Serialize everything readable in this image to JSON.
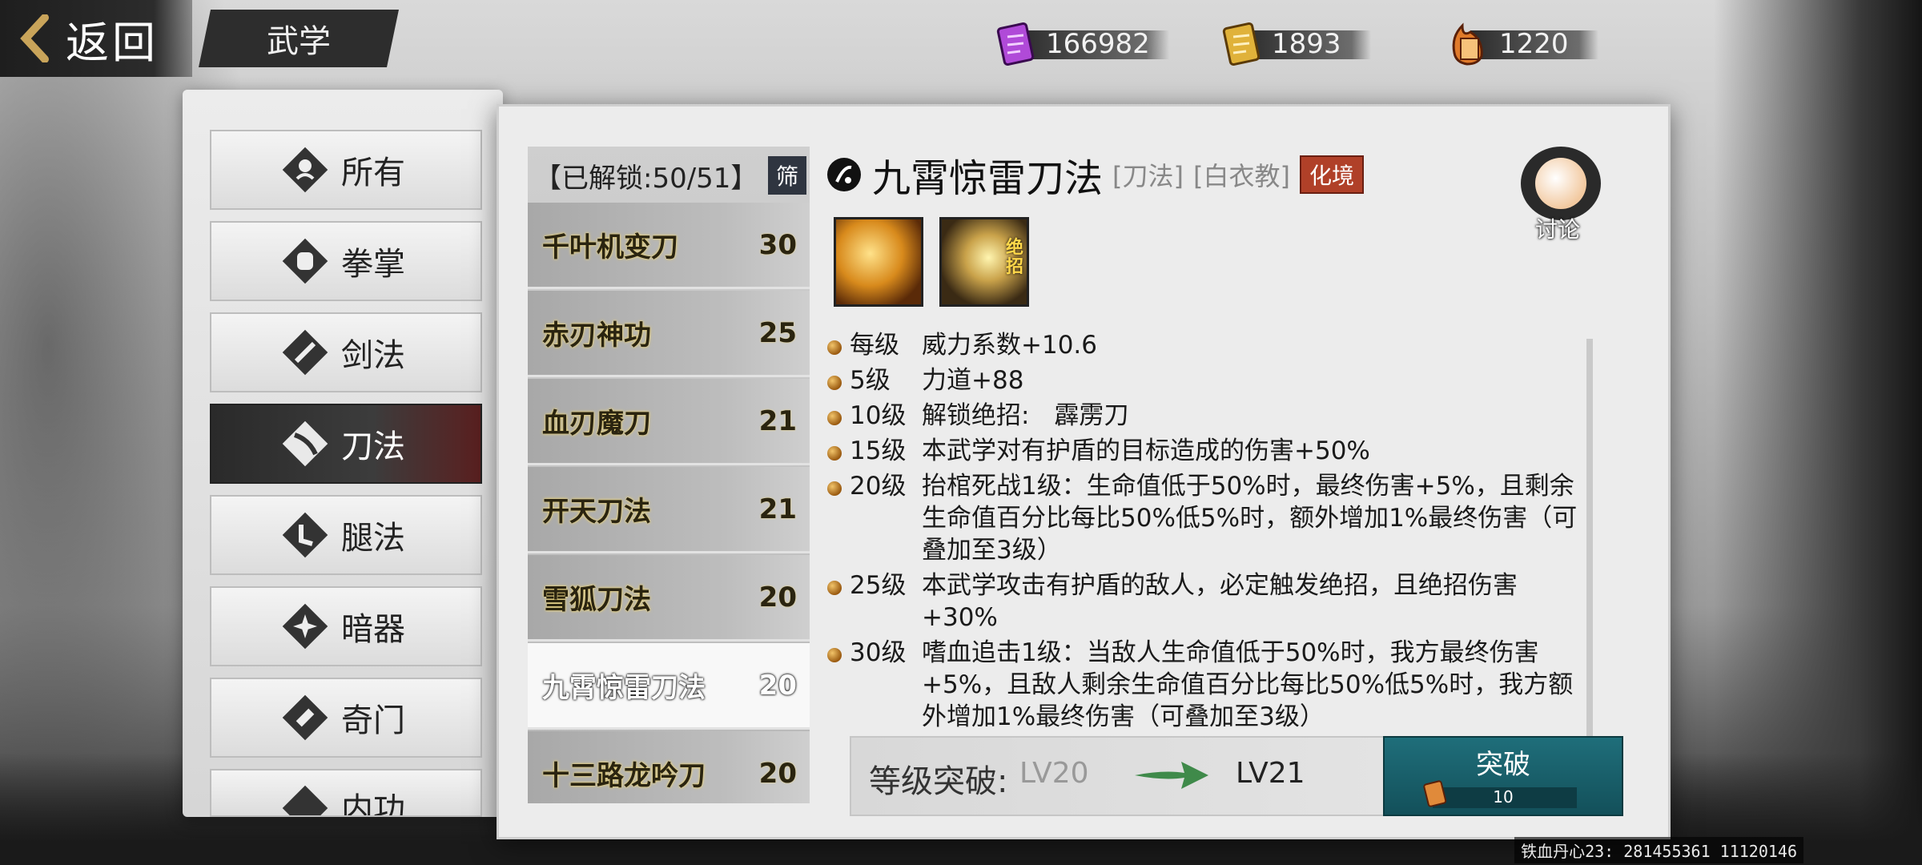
{
  "header": {
    "back_label": "返回",
    "title": "武学"
  },
  "currencies": [
    {
      "icon": "purple-scroll-icon",
      "value": "166982",
      "color": "#b04ad8"
    },
    {
      "icon": "gold-scroll-icon",
      "value": "1893",
      "color": "#e0b23a"
    },
    {
      "icon": "fire-scroll-icon",
      "value": "1220",
      "color": "#e07a2a"
    }
  ],
  "categories": [
    {
      "label": "所有",
      "icon": "all-styles-icon"
    },
    {
      "label": "拳掌",
      "icon": "fist-icon"
    },
    {
      "label": "剑法",
      "icon": "sword-icon"
    },
    {
      "label": "刀法",
      "icon": "blade-icon",
      "active": true
    },
    {
      "label": "腿法",
      "icon": "leg-icon"
    },
    {
      "label": "暗器",
      "icon": "shuriken-icon"
    },
    {
      "label": "奇门",
      "icon": "scroll-weapon-icon"
    },
    {
      "label": "内功",
      "icon": "inner-power-icon"
    }
  ],
  "list": {
    "unlock_text": "【已解锁:50/51】",
    "filter_label": "筛",
    "items": [
      {
        "name": "千叶机变刀",
        "level": "30"
      },
      {
        "name": "赤刃神功",
        "level": "25"
      },
      {
        "name": "血刃魔刀",
        "level": "21"
      },
      {
        "name": "开天刀法",
        "level": "21"
      },
      {
        "name": "雪狐刀法",
        "level": "20"
      },
      {
        "name": "九霄惊雷刀法",
        "level": "20",
        "selected": true
      },
      {
        "name": "十三路龙吟刀",
        "level": "20"
      }
    ]
  },
  "detail": {
    "name": "九霄惊雷刀法",
    "type_tag": "[刀法]",
    "sect_tag": "[白衣教]",
    "realm": "化境",
    "ultimate_badge": "绝招",
    "discuss_label": "讨论",
    "effects": [
      {
        "lv": "每级",
        "text": "威力系数+10.6"
      },
      {
        "lv": "5级",
        "text": "力道+88"
      },
      {
        "lv": "10级",
        "text": "解锁绝招:　霹雳刀"
      },
      {
        "lv": "15级",
        "text": "本武学对有护盾的目标造成的伤害+50%"
      },
      {
        "lv": "20级",
        "text": "抬棺死战1级：生命值低于50%时，最终伤害+5%，且剩余生命值百分比每比50%低5%时，额外增加1%最终伤害（可叠加至3级）"
      },
      {
        "lv": "25级",
        "text": "本武学攻击有护盾的敌人，必定触发绝招，且绝招伤害+30%"
      },
      {
        "lv": "30级",
        "text": "嗜血追击1级：当敌人生命值低于50%时，我方最终伤害+5%，且敌人剩余生命值百分比每比50%低5%时，我方额外增加1%最终伤害（可叠加至3级）"
      }
    ]
  },
  "breakthrough": {
    "label": "等级突破:",
    "from": "LV20",
    "to": "LV21",
    "button_label": "突破",
    "cost": "10"
  },
  "footer": {
    "info": "铁血丹心23: 281455361  11120146"
  }
}
